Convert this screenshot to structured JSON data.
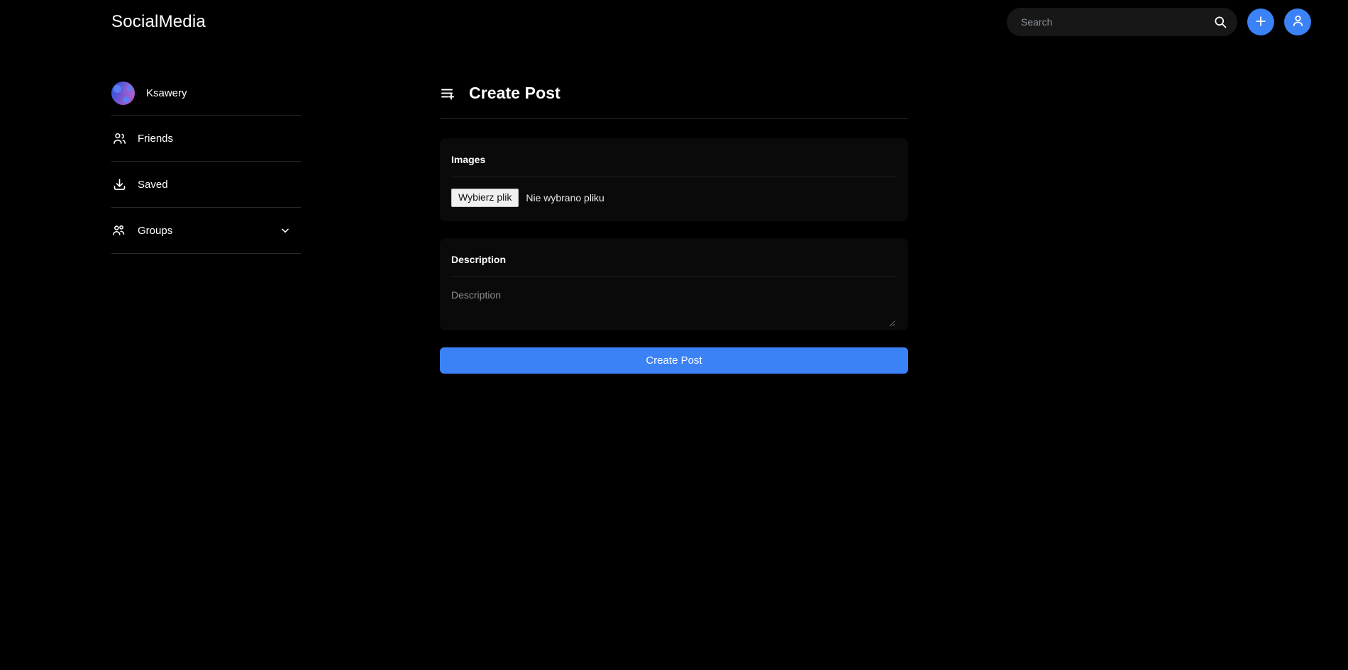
{
  "app": {
    "brand": "SocialMedia",
    "accent_color": "#3b82f6",
    "background_color": "#000000",
    "card_color": "#0a0a0a"
  },
  "header": {
    "search": {
      "value": "",
      "placeholder": "Search",
      "icon": "search-icon"
    },
    "add_button": {
      "icon": "plus-icon",
      "label": ""
    },
    "account_button": {
      "icon": "user-icon",
      "label": ""
    }
  },
  "sidebar": {
    "profile": {
      "name": "Ksawery",
      "avatar": "user-avatar"
    },
    "items": [
      {
        "label": "Friends",
        "icon": "friends-icon",
        "expandable": false
      },
      {
        "label": "Saved",
        "icon": "save-download-icon",
        "expandable": false
      },
      {
        "label": "Groups",
        "icon": "groups-icon",
        "expandable": true,
        "chevron": "chevron-down-icon"
      }
    ]
  },
  "main": {
    "title": "Create Post",
    "title_icon": "list-plus-icon",
    "images_card": {
      "label": "Images",
      "file_button_label": "Wybierz plik",
      "file_status": "Nie wybrano pliku"
    },
    "description_card": {
      "label": "Description",
      "value": "",
      "placeholder": "Description"
    },
    "submit_label": "Create Post"
  }
}
